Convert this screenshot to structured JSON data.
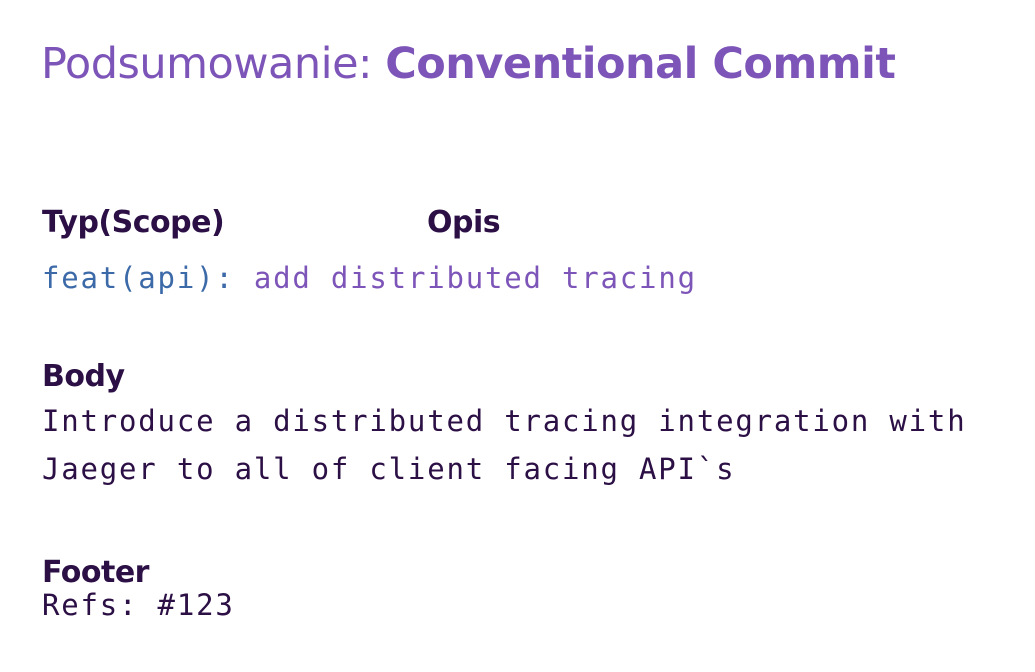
{
  "title": {
    "prefix": "Podsumowanie: ",
    "emphasis": "Conventional Commit"
  },
  "labels": {
    "type_scope": "Typ(Scope)",
    "description": "Opis",
    "body": "Body",
    "footer": "Footer"
  },
  "commit": {
    "type_scope": "feat(api):",
    "description": " add distributed tracing"
  },
  "body_lines": [
    "Introduce a distributed tracing integration with",
    "Jaeger to all of client facing API`s"
  ],
  "footer_text": "Refs: #123",
  "colors": {
    "accent_purple": "#7d55b8",
    "heading_dark": "#2b0f45",
    "type_blue": "#3c6aa8"
  }
}
